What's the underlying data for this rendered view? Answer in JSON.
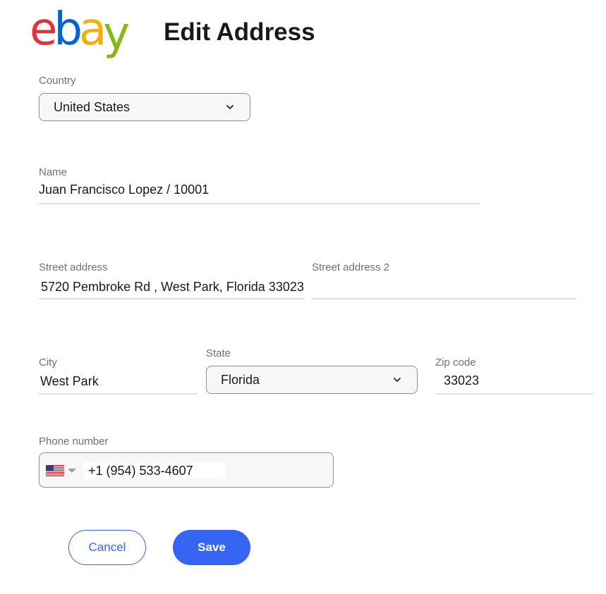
{
  "brand": {
    "logo_text": "ebay"
  },
  "page": {
    "title": "Edit Address"
  },
  "form": {
    "country": {
      "label": "Country",
      "value": "United States"
    },
    "name": {
      "label": "Name",
      "value": "Juan Francisco Lopez  / 10001"
    },
    "street1": {
      "label": "Street address",
      "value": "5720 Pembroke Rd , West Park, Florida 33023"
    },
    "street2": {
      "label": "Street address 2",
      "value": ""
    },
    "city": {
      "label": "City",
      "value": "West Park"
    },
    "state": {
      "label": "State",
      "value": "Florida"
    },
    "zip": {
      "label": "Zip code",
      "value": "33023"
    },
    "phone": {
      "label": "Phone number",
      "value": "+1 (954) 533-4607",
      "country_flag": "us-flag-icon"
    }
  },
  "actions": {
    "cancel_label": "Cancel",
    "save_label": "Save"
  },
  "colors": {
    "accent": "#3665f3",
    "label": "#707070",
    "border": "#8f8f8f",
    "underline": "#e1e1e1"
  }
}
